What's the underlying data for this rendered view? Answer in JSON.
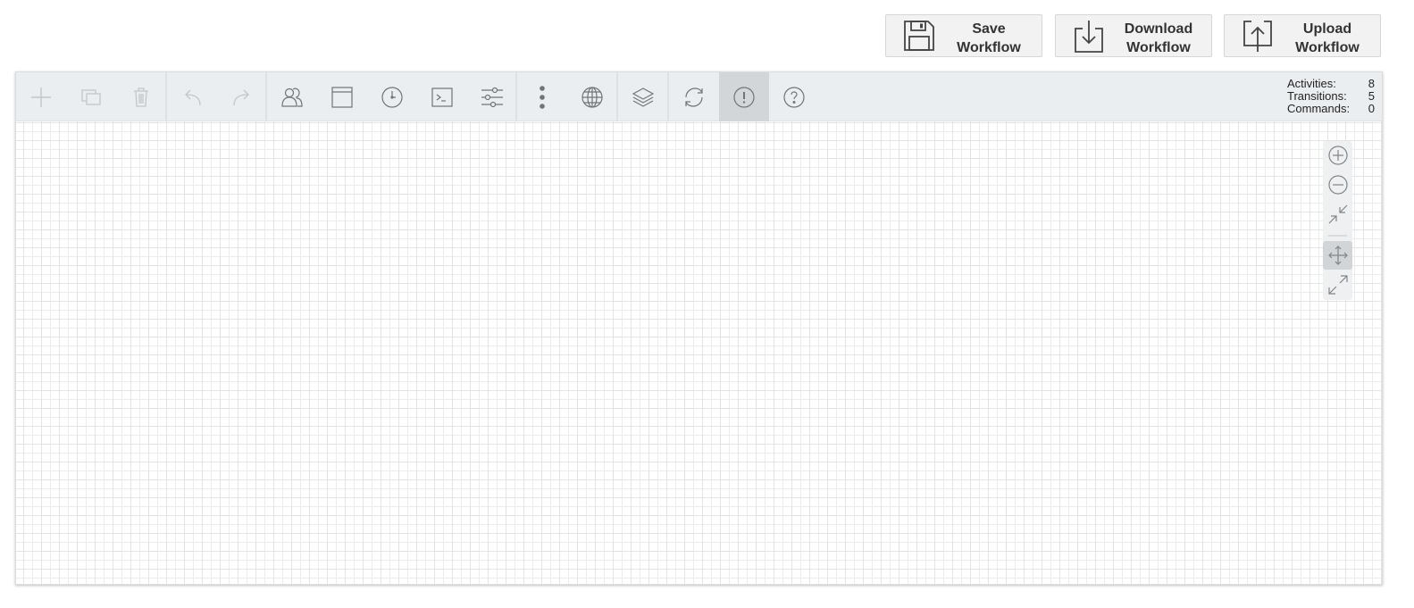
{
  "header": {
    "save_label": "Save\nWorkflow",
    "download_label": "Download\nWorkflow",
    "upload_label": "Upload\nWorkflow"
  },
  "toolbar": {
    "buttons": [
      {
        "icon": "plus-icon",
        "enabled": false
      },
      {
        "icon": "copy-icon",
        "enabled": false
      },
      {
        "icon": "trash-icon",
        "enabled": false
      },
      {
        "icon": "undo-icon",
        "enabled": false
      },
      {
        "icon": "redo-icon",
        "enabled": false
      },
      {
        "icon": "actors-icon",
        "enabled": true
      },
      {
        "icon": "window-icon",
        "enabled": true
      },
      {
        "icon": "clock-icon",
        "enabled": true
      },
      {
        "icon": "terminal-icon",
        "enabled": true
      },
      {
        "icon": "sliders-icon",
        "enabled": true
      },
      {
        "icon": "more-vertical-icon",
        "enabled": true
      },
      {
        "icon": "globe-icon",
        "enabled": true
      },
      {
        "icon": "layers-icon",
        "enabled": true
      },
      {
        "icon": "refresh-icon",
        "enabled": true
      },
      {
        "icon": "alert-icon",
        "enabled": true,
        "active": true
      },
      {
        "icon": "help-icon",
        "enabled": true
      }
    ]
  },
  "stats": {
    "activities_label": "Activities:",
    "activities_value": "8",
    "transitions_label": "Transitions:",
    "transitions_value": "5",
    "commands_label": "Commands:",
    "commands_value": "0"
  },
  "zoom": {
    "buttons": [
      "zoom-in-icon",
      "zoom-out-icon",
      "shrink-icon",
      "move-icon",
      "expand-icon"
    ],
    "active": "move-icon"
  },
  "colors": {
    "toolbar_bg": "#ebeef0",
    "icon_enabled": "#6f7478",
    "icon_disabled": "#c2c6c9",
    "active_bg": "#d3d6d8"
  }
}
